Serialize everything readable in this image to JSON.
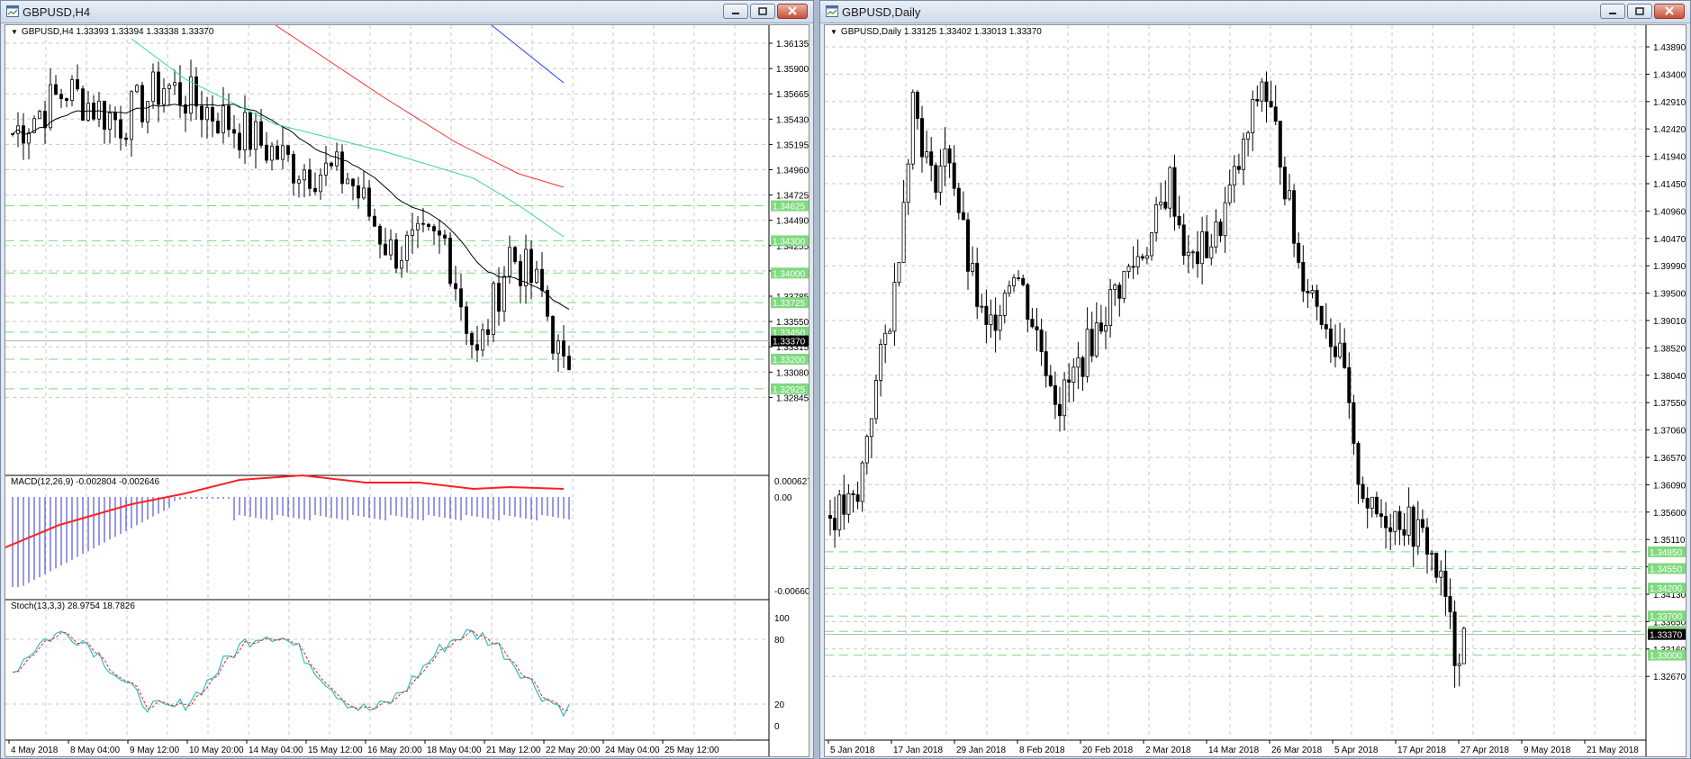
{
  "windows": [
    {
      "title": "GBPUSD,H4",
      "symbol_line": "GBPUSD,H4  1.33393 1.33394 1.33338 1.33370",
      "macd_label": "MACD(12,26,9) -0.002804 -0.002646",
      "stoch_label": "Stoch(13,3,3) 28.9754 18.7826",
      "price_ticks": [
        "1.36135",
        "1.35900",
        "1.35665",
        "1.35430",
        "1.35195",
        "1.34960",
        "1.34725",
        "1.34490",
        "1.34255",
        "1.34020",
        "1.33785",
        "1.33550",
        "1.33315",
        "1.33080",
        "1.32845"
      ],
      "current_price": "1.33370",
      "level_labels": [
        "1.34625",
        "1.34300",
        "1.34000",
        "1.33725",
        "1.33450",
        "1.33200",
        "1.32925"
      ],
      "macd_ticks": [
        "0.000627",
        "0.00",
        "-0.006608"
      ],
      "stoch_ticks": [
        "100",
        "80",
        "20",
        "0"
      ],
      "date_ticks": [
        "4 May 2018",
        "8 May 04:00",
        "9 May 12:00",
        "10 May 20:00",
        "14 May 04:00",
        "15 May 12:00",
        "16 May 20:00",
        "18 May 04:00",
        "21 May 12:00",
        "22 May 20:00",
        "24 May 04:00",
        "25 May 12:00"
      ]
    },
    {
      "title": "GBPUSD,Daily",
      "symbol_line": "GBPUSD,Daily  1.33125 1.33402 1.33013 1.33370",
      "price_ticks": [
        "1.43890",
        "1.43400",
        "1.42910",
        "1.42420",
        "1.41940",
        "1.41450",
        "1.40960",
        "1.40470",
        "1.39990",
        "1.39500",
        "1.39010",
        "1.38520",
        "1.38040",
        "1.37550",
        "1.37060",
        "1.36570",
        "1.36090",
        "1.35600",
        "1.35110",
        "1.34620",
        "1.34130",
        "1.33650",
        "1.33160",
        "1.32670"
      ],
      "current_price": "1.33370",
      "level_labels": [
        "1.34850",
        "1.34550",
        "1.34200",
        "1.33700",
        "1.33425",
        "1.33000"
      ],
      "date_ticks": [
        "5 Jan 2018",
        "17 Jan 2018",
        "29 Jan 2018",
        "8 Feb 2018",
        "20 Feb 2018",
        "2 Mar 2018",
        "14 Mar 2018",
        "26 Mar 2018",
        "5 Apr 2018",
        "17 Apr 2018",
        "27 Apr 2018",
        "9 May 2018",
        "21 May 2018"
      ]
    }
  ],
  "icons": [
    "chart-window-icon",
    "minimize-icon",
    "restore-icon",
    "close-icon"
  ],
  "colors": {
    "level_green": "#7fd97f",
    "ma_red": "#ff2d2d",
    "ma_blue": "#1e3cff",
    "ma_green": "#31d7a0",
    "macd_blue": "#3030c8",
    "macd_signal": "#ff2020",
    "stoch_main": "#2bc0c8",
    "stoch_signal": "#ff2020"
  }
}
